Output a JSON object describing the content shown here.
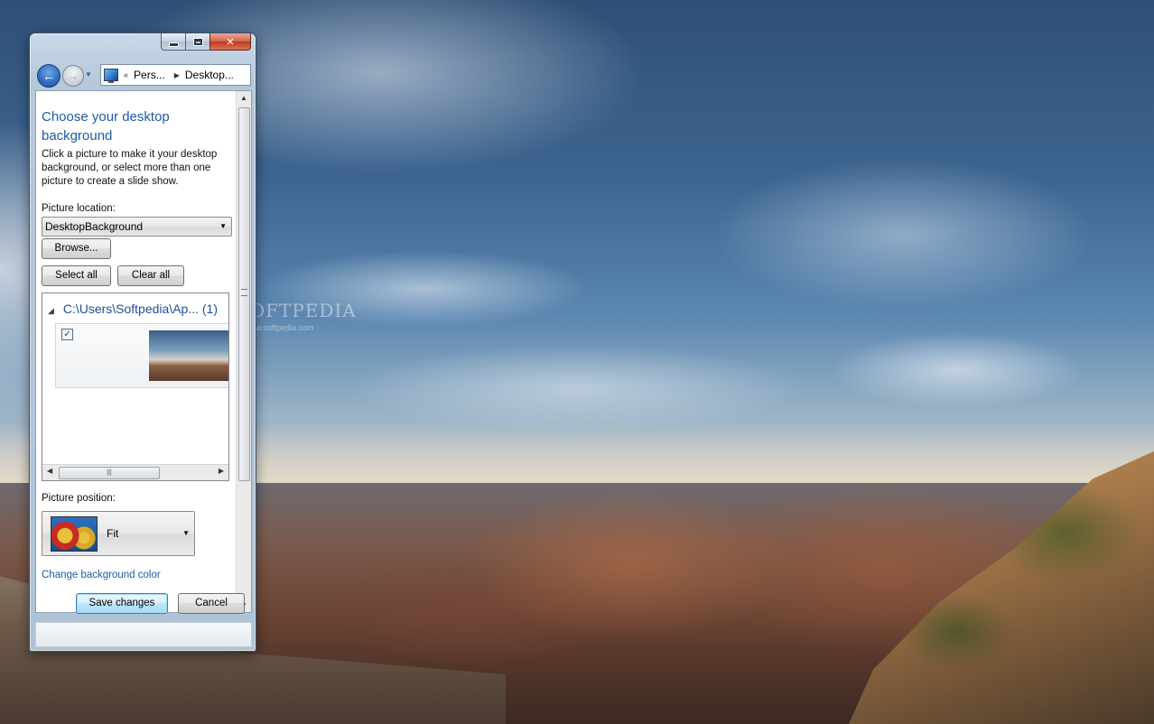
{
  "window": {
    "title_buttons": {
      "minimize": "minimize",
      "maximize": "maximize",
      "close": "✕"
    }
  },
  "navigation": {
    "breadcrumb_prefix": "«",
    "breadcrumb": [
      "Pers...",
      "Desktop..."
    ]
  },
  "page": {
    "title": "Choose your desktop background",
    "description": "Click a picture to make it your desktop background, or select more than one picture to create a slide show.",
    "picture_location_label": "Picture location:",
    "picture_location_value": "DesktopBackground",
    "browse_label": "Browse...",
    "select_all_label": "Select all",
    "clear_all_label": "Clear all",
    "group_header": "C:\\Users\\Softpedia\\Ap...",
    "group_count": "(1)",
    "picture_checked": "✓",
    "picture_position_label": "Picture position:",
    "picture_position_value": "Fit",
    "change_color_link": "Change background color"
  },
  "footer": {
    "save_label": "Save changes",
    "cancel_label": "Cancel"
  },
  "desktop": {
    "watermark": "SOFTPEDIA",
    "watermark_sub": "www.softpedia.com"
  },
  "icons": [
    "back-arrow-icon",
    "forward-arrow-icon",
    "display-icon",
    "chevron-down-icon",
    "expand-triangle-icon",
    "checkbox-icon",
    "scroll-arrow-icon"
  ],
  "colors": {
    "link_blue": "#1e5aa8",
    "close_red": "#c0391e",
    "title_blue": "#1e5aa8"
  }
}
